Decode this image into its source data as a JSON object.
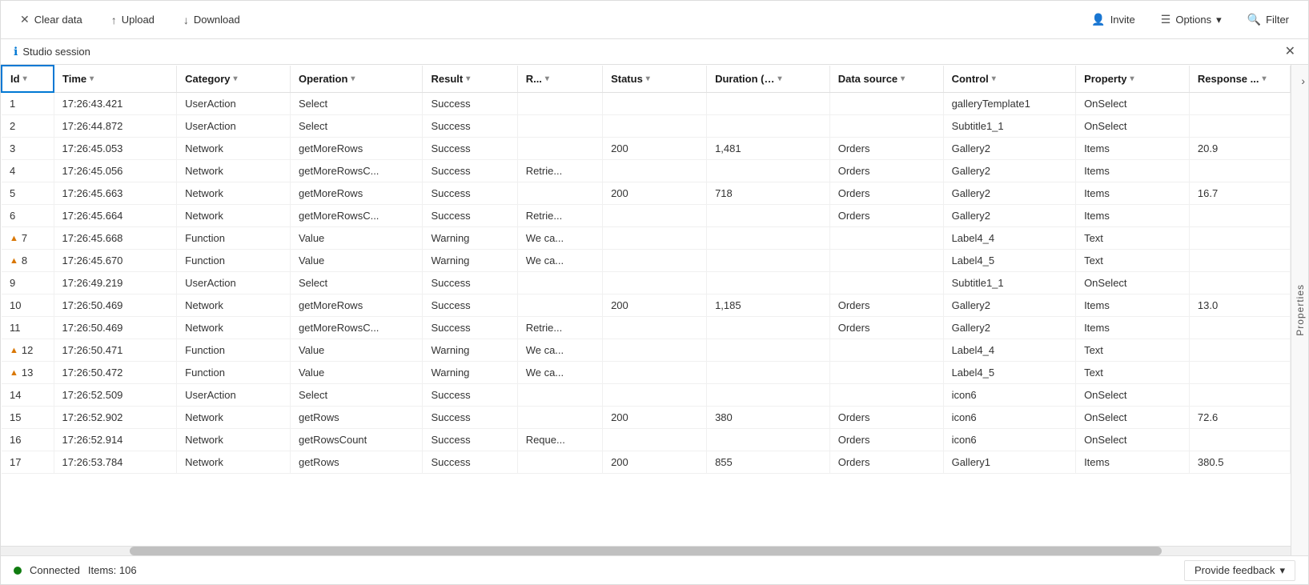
{
  "toolbar": {
    "clear_data_label": "Clear data",
    "upload_label": "Upload",
    "download_label": "Download",
    "invite_label": "Invite",
    "options_label": "Options",
    "filter_label": "Filter"
  },
  "session_bar": {
    "label": "Studio session"
  },
  "columns": [
    {
      "id": "id",
      "label": "Id",
      "sortable": true
    },
    {
      "id": "time",
      "label": "Time",
      "sortable": true
    },
    {
      "id": "category",
      "label": "Category",
      "sortable": true
    },
    {
      "id": "operation",
      "label": "Operation",
      "sortable": true
    },
    {
      "id": "result",
      "label": "Result",
      "sortable": true
    },
    {
      "id": "r",
      "label": "R...",
      "sortable": true
    },
    {
      "id": "status",
      "label": "Status",
      "sortable": true
    },
    {
      "id": "duration",
      "label": "Duration (..…",
      "sortable": true
    },
    {
      "id": "datasource",
      "label": "Data source",
      "sortable": true
    },
    {
      "id": "control",
      "label": "Control",
      "sortable": true
    },
    {
      "id": "property",
      "label": "Property",
      "sortable": true
    },
    {
      "id": "response",
      "label": "Response ...",
      "sortable": true
    }
  ],
  "rows": [
    {
      "id": 1,
      "warning": false,
      "time": "17:26:43.421",
      "category": "UserAction",
      "operation": "Select",
      "result": "Success",
      "r": "",
      "status": "",
      "duration": "",
      "datasource": "",
      "control": "galleryTemplate1",
      "property": "OnSelect",
      "response": ""
    },
    {
      "id": 2,
      "warning": false,
      "time": "17:26:44.872",
      "category": "UserAction",
      "operation": "Select",
      "result": "Success",
      "r": "",
      "status": "",
      "duration": "",
      "datasource": "",
      "control": "Subtitle1_1",
      "property": "OnSelect",
      "response": ""
    },
    {
      "id": 3,
      "warning": false,
      "time": "17:26:45.053",
      "category": "Network",
      "operation": "getMoreRows",
      "result": "Success",
      "r": "",
      "status": "200",
      "duration": "1,481",
      "datasource": "Orders",
      "control": "Gallery2",
      "property": "Items",
      "response": "20.9"
    },
    {
      "id": 4,
      "warning": false,
      "time": "17:26:45.056",
      "category": "Network",
      "operation": "getMoreRowsC...",
      "result": "Success",
      "r": "Retrie...",
      "status": "",
      "duration": "",
      "datasource": "Orders",
      "control": "Gallery2",
      "property": "Items",
      "response": ""
    },
    {
      "id": 5,
      "warning": false,
      "time": "17:26:45.663",
      "category": "Network",
      "operation": "getMoreRows",
      "result": "Success",
      "r": "",
      "status": "200",
      "duration": "718",
      "datasource": "Orders",
      "control": "Gallery2",
      "property": "Items",
      "response": "16.7"
    },
    {
      "id": 6,
      "warning": false,
      "time": "17:26:45.664",
      "category": "Network",
      "operation": "getMoreRowsC...",
      "result": "Success",
      "r": "Retrie...",
      "status": "",
      "duration": "",
      "datasource": "Orders",
      "control": "Gallery2",
      "property": "Items",
      "response": ""
    },
    {
      "id": 7,
      "warning": true,
      "time": "17:26:45.668",
      "category": "Function",
      "operation": "Value",
      "result": "Warning",
      "r": "We ca...",
      "status": "",
      "duration": "",
      "datasource": "",
      "control": "Label4_4",
      "property": "Text",
      "response": ""
    },
    {
      "id": 8,
      "warning": true,
      "time": "17:26:45.670",
      "category": "Function",
      "operation": "Value",
      "result": "Warning",
      "r": "We ca...",
      "status": "",
      "duration": "",
      "datasource": "",
      "control": "Label4_5",
      "property": "Text",
      "response": ""
    },
    {
      "id": 9,
      "warning": false,
      "time": "17:26:49.219",
      "category": "UserAction",
      "operation": "Select",
      "result": "Success",
      "r": "",
      "status": "",
      "duration": "",
      "datasource": "",
      "control": "Subtitle1_1",
      "property": "OnSelect",
      "response": ""
    },
    {
      "id": 10,
      "warning": false,
      "time": "17:26:50.469",
      "category": "Network",
      "operation": "getMoreRows",
      "result": "Success",
      "r": "",
      "status": "200",
      "duration": "1,185",
      "datasource": "Orders",
      "control": "Gallery2",
      "property": "Items",
      "response": "13.0"
    },
    {
      "id": 11,
      "warning": false,
      "time": "17:26:50.469",
      "category": "Network",
      "operation": "getMoreRowsC...",
      "result": "Success",
      "r": "Retrie...",
      "status": "",
      "duration": "",
      "datasource": "Orders",
      "control": "Gallery2",
      "property": "Items",
      "response": ""
    },
    {
      "id": 12,
      "warning": true,
      "time": "17:26:50.471",
      "category": "Function",
      "operation": "Value",
      "result": "Warning",
      "r": "We ca...",
      "status": "",
      "duration": "",
      "datasource": "",
      "control": "Label4_4",
      "property": "Text",
      "response": ""
    },
    {
      "id": 13,
      "warning": true,
      "time": "17:26:50.472",
      "category": "Function",
      "operation": "Value",
      "result": "Warning",
      "r": "We ca...",
      "status": "",
      "duration": "",
      "datasource": "",
      "control": "Label4_5",
      "property": "Text",
      "response": ""
    },
    {
      "id": 14,
      "warning": false,
      "time": "17:26:52.509",
      "category": "UserAction",
      "operation": "Select",
      "result": "Success",
      "r": "",
      "status": "",
      "duration": "",
      "datasource": "",
      "control": "icon6",
      "property": "OnSelect",
      "response": ""
    },
    {
      "id": 15,
      "warning": false,
      "time": "17:26:52.902",
      "category": "Network",
      "operation": "getRows",
      "result": "Success",
      "r": "",
      "status": "200",
      "duration": "380",
      "datasource": "Orders",
      "control": "icon6",
      "property": "OnSelect",
      "response": "72.6"
    },
    {
      "id": 16,
      "warning": false,
      "time": "17:26:52.914",
      "category": "Network",
      "operation": "getRowsCount",
      "result": "Success",
      "r": "Reque...",
      "status": "",
      "duration": "",
      "datasource": "Orders",
      "control": "icon6",
      "property": "OnSelect",
      "response": ""
    },
    {
      "id": 17,
      "warning": false,
      "time": "17:26:53.784",
      "category": "Network",
      "operation": "getRows",
      "result": "Success",
      "r": "",
      "status": "200",
      "duration": "855",
      "datasource": "Orders",
      "control": "Gallery1",
      "property": "Items",
      "response": "380.5"
    }
  ],
  "status_bar": {
    "connected_label": "Connected",
    "items_label": "Items: 106",
    "provide_feedback_label": "Provide feedback"
  },
  "properties_sidebar": {
    "label": "Properties"
  }
}
